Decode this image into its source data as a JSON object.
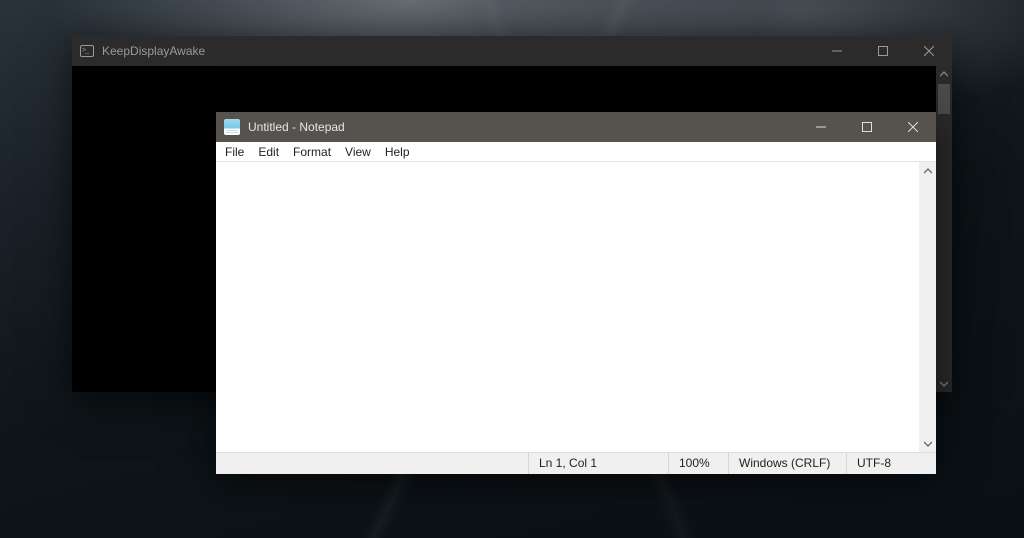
{
  "console_window": {
    "title": "KeepDisplayAwake"
  },
  "notepad_window": {
    "title": "Untitled - Notepad",
    "menu": {
      "file": "File",
      "edit": "Edit",
      "format": "Format",
      "view": "View",
      "help": "Help"
    },
    "editor": {
      "content": ""
    },
    "status": {
      "cursor": "Ln 1, Col 1",
      "zoom": "100%",
      "line_ending": "Windows (CRLF)",
      "encoding": "UTF-8"
    }
  }
}
